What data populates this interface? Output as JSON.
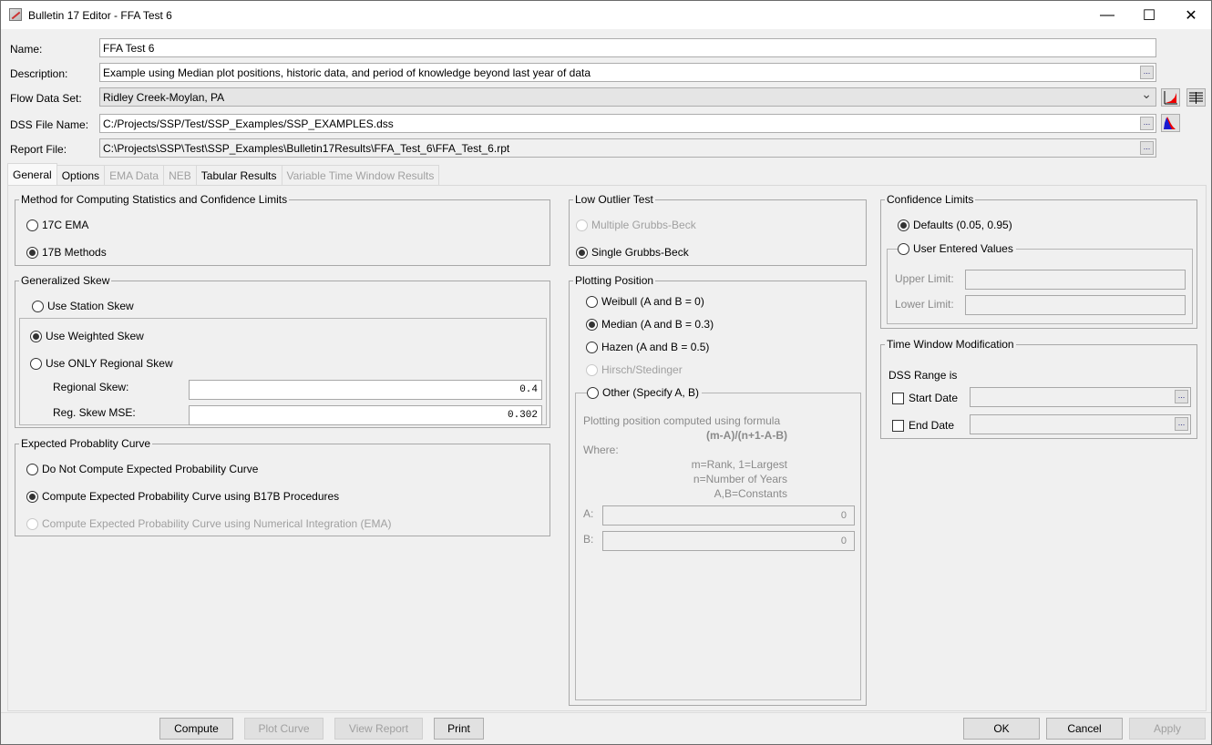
{
  "window": {
    "title": "Bulletin 17 Editor - FFA Test 6",
    "controls": {
      "minimize": "—",
      "maximize": "☐",
      "close": "✕"
    }
  },
  "form": {
    "name_label": "Name:",
    "name_value": "FFA Test 6",
    "description_label": "Description:",
    "description_value": "Example using Median plot positions, historic data, and period of knowledge beyond last year of data",
    "flow_label": "Flow Data Set:",
    "flow_value": "Ridley Creek-Moylan, PA",
    "dss_label": "DSS File Name:",
    "dss_value": "C:/Projects/SSP/Test/SSP_Examples/SSP_EXAMPLES.dss",
    "report_label": "Report File:",
    "report_value": "C:\\Projects\\SSP\\Test\\SSP_Examples\\Bulletin17Results\\FFA_Test_6\\FFA_Test_6.rpt",
    "browse": "...",
    "dropdown_arrow": "⌄"
  },
  "tabs": [
    {
      "label": "General",
      "active": true,
      "enabled": true
    },
    {
      "label": "Options",
      "active": false,
      "enabled": true
    },
    {
      "label": "EMA Data",
      "active": false,
      "enabled": false
    },
    {
      "label": "NEB",
      "active": false,
      "enabled": false
    },
    {
      "label": "Tabular Results",
      "active": false,
      "enabled": true
    },
    {
      "label": "Variable Time Window Results",
      "active": false,
      "enabled": false
    }
  ],
  "method": {
    "title": "Method for Computing Statistics and Confidence Limits",
    "options": [
      "17C EMA",
      "17B Methods"
    ],
    "selected": "17B Methods"
  },
  "skew": {
    "title": "Generalized Skew",
    "station": "Use Station Skew",
    "weighted": "Use Weighted Skew",
    "regional_only": "Use ONLY Regional Skew",
    "selected": "Use Weighted Skew",
    "regional_skew_label": "Regional Skew:",
    "regional_skew_value": "0.4",
    "mse_label": "Reg. Skew MSE:",
    "mse_value": "0.302"
  },
  "expected": {
    "title": "Expected Probablity Curve",
    "options": [
      "Do Not Compute Expected Probability Curve",
      "Compute Expected Probability Curve using B17B Procedures",
      "Compute Expected Probability Curve using Numerical Integration (EMA)"
    ],
    "selected": "Compute Expected Probability Curve using B17B Procedures"
  },
  "low_outlier": {
    "title": "Low Outlier Test",
    "options": [
      "Multiple Grubbs-Beck",
      "Single Grubbs-Beck"
    ],
    "selected": "Single Grubbs-Beck"
  },
  "plotting": {
    "title": "Plotting Position",
    "options": [
      "Weibull (A and B = 0)",
      "Median (A and B = 0.3)",
      "Hazen (A and B = 0.5)",
      "Hirsch/Stedinger"
    ],
    "selected": "Median (A and B = 0.3)",
    "other_label": "Other (Specify A, B)",
    "formula_intro": "Plotting position computed using formula",
    "formula": "(m-A)/(n+1-A-B)",
    "where": "Where:",
    "def_m": "m=Rank, 1=Largest",
    "def_n": "n=Number of Years",
    "def_ab": "A,B=Constants",
    "a_label": "A:",
    "a_value": "0",
    "b_label": "B:",
    "b_value": "0"
  },
  "confidence": {
    "title": "Confidence Limits",
    "defaults": "Defaults (0.05, 0.95)",
    "user": "User Entered Values",
    "selected": "Defaults (0.05, 0.95)",
    "upper_label": "Upper Limit:",
    "lower_label": "Lower Limit:",
    "upper_value": "",
    "lower_value": ""
  },
  "time_window": {
    "title": "Time Window Modification",
    "range_label": "DSS Range is",
    "start_label": "Start Date",
    "end_label": "End Date",
    "start_value": "",
    "end_value": ""
  },
  "buttons": {
    "compute": "Compute",
    "plot_curve": "Plot Curve",
    "view_report": "View Report",
    "print": "Print",
    "ok": "OK",
    "cancel": "Cancel",
    "apply": "Apply"
  }
}
